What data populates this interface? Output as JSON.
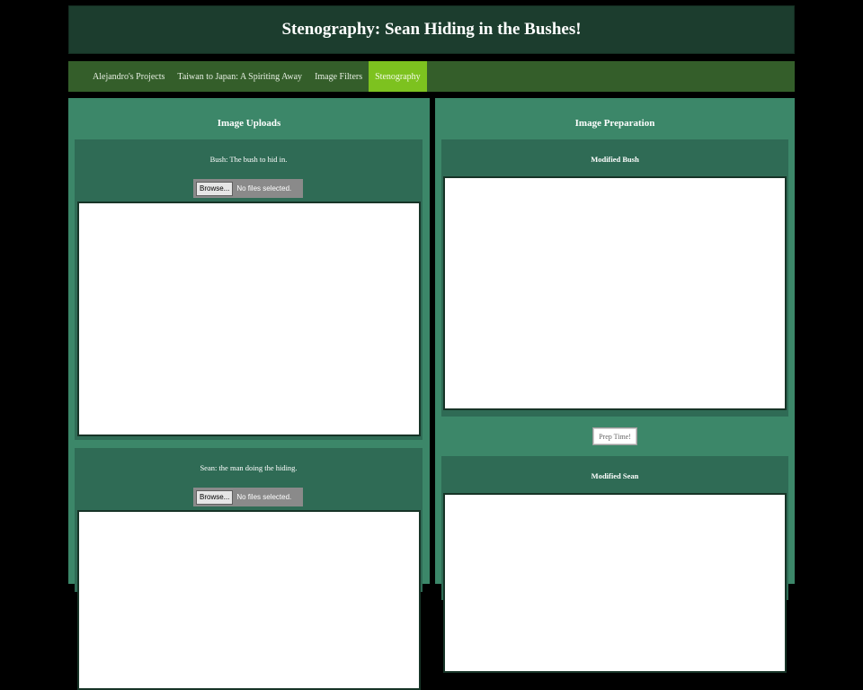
{
  "header": {
    "title": "Stenography: Sean Hiding in the Bushes!"
  },
  "nav": {
    "items": [
      {
        "label": "Alejandro's Projects",
        "active": false
      },
      {
        "label": "Taiwan to Japan: A Spiriting Away",
        "active": false
      },
      {
        "label": "Image Filters",
        "active": false
      },
      {
        "label": "Stenography",
        "active": true
      }
    ]
  },
  "uploads": {
    "title": "Image Uploads",
    "bush": {
      "label": "Bush: The bush to hid in.",
      "browse_label": "Browse...",
      "file_status": "No files selected."
    },
    "sean": {
      "label": "Sean: the man doing the hiding.",
      "browse_label": "Browse...",
      "file_status": "No files selected."
    }
  },
  "preparation": {
    "title": "Image Preparation",
    "modified_bush_label": "Modified Bush",
    "prep_button_label": "Prep Time!",
    "modified_sean_label": "Modified Sean"
  },
  "colors": {
    "header_bg": "#1c3d2e",
    "nav_bg": "#345e2a",
    "nav_active": "#7dc21f",
    "column_bg": "#3c8769",
    "panel_bg": "#2f6b55"
  }
}
